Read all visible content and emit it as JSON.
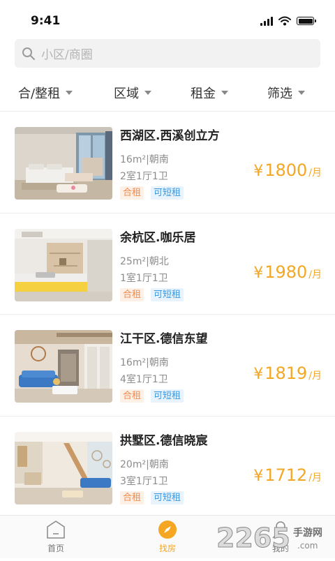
{
  "status_bar": {
    "time": "9:41"
  },
  "search": {
    "placeholder": "小区/商圈"
  },
  "filters": [
    {
      "label": "合/整租"
    },
    {
      "label": "区域"
    },
    {
      "label": "租金"
    },
    {
      "label": "筛选"
    }
  ],
  "listings": [
    {
      "title": "西湖区.西溪创立方",
      "size": "16m²|朝南",
      "rooms": "2室1厅1卫",
      "tag_type": "合租",
      "tag_short": "可短租",
      "currency": "¥",
      "price": "1800",
      "unit": "/月",
      "photo": "bedroom-photo-1"
    },
    {
      "title": "余杭区.咖乐居",
      "size": "25m²|朝北",
      "rooms": "1室1厅1卫",
      "tag_type": "合租",
      "tag_short": "可短租",
      "currency": "¥",
      "price": "1980",
      "unit": "/月",
      "photo": "bedroom-photo-2"
    },
    {
      "title": "江干区.德信东望",
      "size": "16m²|朝南",
      "rooms": "4室1厅1卫",
      "tag_type": "合租",
      "tag_short": "可短租",
      "currency": "¥",
      "price": "1819",
      "unit": "/月",
      "photo": "living-room-photo-1"
    },
    {
      "title": "拱墅区.德信晓宸",
      "size": "20m²|朝南",
      "rooms": "3室1厅1卫",
      "tag_type": "合租",
      "tag_short": "可短租",
      "currency": "¥",
      "price": "1712",
      "unit": "/月",
      "photo": "living-room-photo-2"
    }
  ],
  "tabs": [
    {
      "label": "首页",
      "icon": "home-icon"
    },
    {
      "label": "找房",
      "icon": "compass-icon",
      "active": true
    },
    {
      "label": "我的",
      "icon": "user-icon"
    }
  ],
  "watermark": {
    "text": "2265",
    "sub": "手游网",
    "url": ".com"
  },
  "colors": {
    "accent": "#f5a623",
    "tag_orange": "#f08a4a",
    "tag_blue": "#3a97dd"
  }
}
